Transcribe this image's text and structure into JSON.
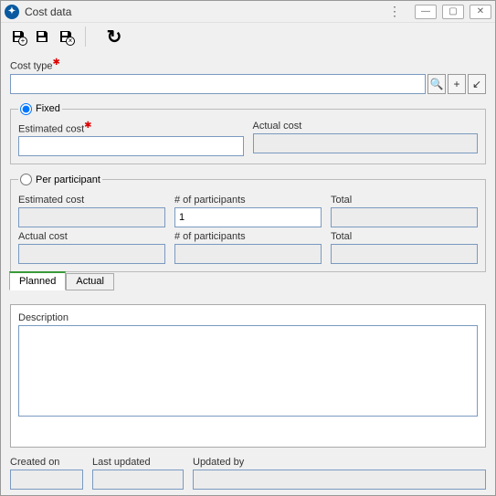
{
  "window": {
    "title": "Cost data"
  },
  "toolbar": {
    "save_new": "+",
    "save": "",
    "save_delete": "×",
    "refresh": "↻"
  },
  "cost_type": {
    "label": "Cost type",
    "value": ""
  },
  "icons": {
    "search": "🔍",
    "plus": "+",
    "link": "↙"
  },
  "fixed": {
    "legend": "Fixed",
    "est_label": "Estimated cost",
    "est_value": "",
    "act_label": "Actual cost",
    "act_value": ""
  },
  "per": {
    "legend": "Per participant",
    "est_label": "Estimated cost",
    "est_value": "",
    "num_label": "# of participants",
    "num_value": "1",
    "total_label": "Total",
    "total_value": "",
    "act_label": "Actual cost",
    "act_value": "",
    "num2_label": "# of participants",
    "num2_value": "",
    "total2_label": "Total",
    "total2_value": ""
  },
  "tabs": {
    "planned": "Planned",
    "actual": "Actual"
  },
  "desc": {
    "label": "Description",
    "value": ""
  },
  "footer": {
    "created_label": "Created on",
    "created_value": "",
    "updated_label": "Last updated",
    "updated_value": "",
    "by_label": "Updated by",
    "by_value": ""
  }
}
